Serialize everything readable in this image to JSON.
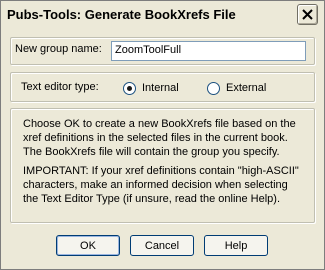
{
  "window": {
    "title": "Pubs-Tools: Generate BookXrefs File"
  },
  "group_name": {
    "label": "New group name:",
    "value": "ZoomToolFull"
  },
  "editor_type": {
    "label": "Text editor type:",
    "options": [
      {
        "label": "Internal",
        "selected": true
      },
      {
        "label": "External",
        "selected": false
      }
    ]
  },
  "description": {
    "paragraph1_lines": [
      "Choose OK to create a new BookXrefs file based on the",
      "xref definitions in the selected files in the current book.",
      "The BookXrefs file will contain the group you specify."
    ],
    "paragraph2_lines": [
      "IMPORTANT: If your xref definitions contain \"high-ASCII\"",
      "characters, make an informed decision when selecting",
      "the Text Editor Type (if unsure, read the online Help)."
    ]
  },
  "buttons": {
    "ok": "OK",
    "cancel": "Cancel",
    "help": "Help"
  }
}
